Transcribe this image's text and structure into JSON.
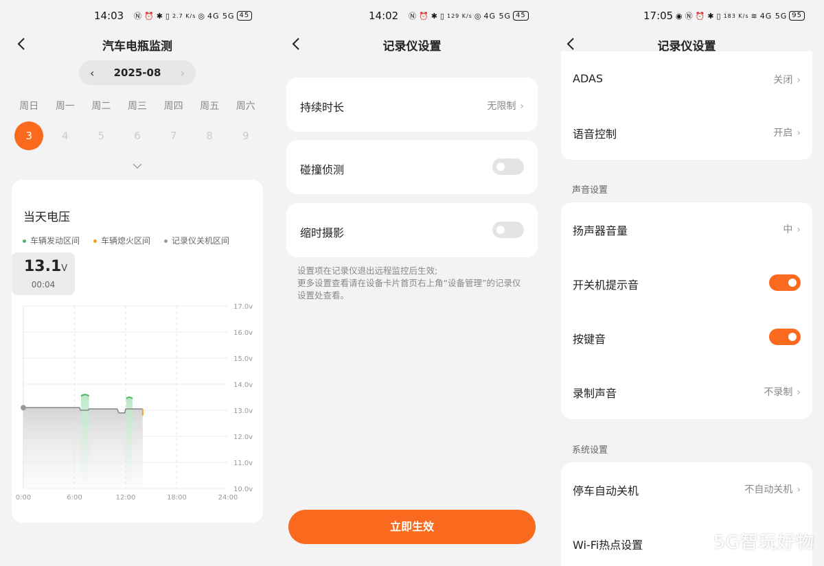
{
  "panel1": {
    "status": {
      "time": "14:03",
      "speed": "2.7 K/s",
      "network": "4G 5G",
      "battery": "45"
    },
    "nav": {
      "title": "汽车电瓶监测"
    },
    "month": "2025-08",
    "weekdays": [
      "周日",
      "周一",
      "周二",
      "周三",
      "周四",
      "周五",
      "周六"
    ],
    "dates": [
      "3",
      "4",
      "5",
      "6",
      "7",
      "8",
      "9"
    ],
    "card_title": "当天电压",
    "legend": [
      {
        "label": "车辆发动区间",
        "color": "#4cb96a"
      },
      {
        "label": "车辆熄火区间",
        "color": "#f0a020"
      },
      {
        "label": "记录仪关机区间",
        "color": "#999999"
      }
    ],
    "tooltip": {
      "value": "13.1",
      "unit": "V",
      "time": "00:04"
    }
  },
  "chart_data": {
    "type": "area",
    "title": "当天电压",
    "x_ticks": [
      "0:00",
      "6:00",
      "12:00",
      "18:00",
      "24:00"
    ],
    "y_ticks": [
      "17.0v",
      "16.0v",
      "15.0v",
      "14.0v",
      "13.0v",
      "12.0v",
      "11.0v",
      "10.0v"
    ],
    "ylim": [
      10,
      17
    ],
    "xlim": [
      0,
      24
    ],
    "grid": true,
    "series": [
      {
        "x": [
          0,
          6.6,
          6.7,
          7.6,
          7.7,
          11.0,
          11.2,
          11.9,
          12.0,
          12.7,
          12.8,
          14.0
        ],
        "y": [
          13.1,
          13.1,
          13.0,
          13.0,
          13.05,
          13.05,
          12.9,
          12.9,
          13.05,
          13.05,
          13.05,
          13.05
        ]
      }
    ],
    "run_intervals": [
      [
        6.6,
        7.7,
        13.6
      ],
      [
        11.9,
        12.8,
        13.5
      ]
    ],
    "stop_marker": 14.0
  },
  "panel2": {
    "status": {
      "time": "14:02",
      "speed": "129 K/s",
      "network": "4G 5G",
      "battery": "45"
    },
    "nav": {
      "title": "记录仪设置"
    },
    "duration": {
      "label": "持续时长",
      "value": "无限制"
    },
    "collision": {
      "label": "碰撞侦测"
    },
    "timelapse": {
      "label": "缩时摄影"
    },
    "note": "设置项在记录仪退出远程监控后生效;\n更多设置查看请在设备卡片首页右上角“设备管理”的记录仪设置处查看。",
    "cta": "立即生效"
  },
  "panel3": {
    "status": {
      "time": "17:05",
      "speed": "183 K/s",
      "network": "4G 5G",
      "battery": "95"
    },
    "nav": {
      "title": "记录仪设置"
    },
    "adas": {
      "label": "ADAS",
      "value": "关闭"
    },
    "voice": {
      "label": "语音控制",
      "value": "开启"
    },
    "sound_section": "声音设置",
    "speaker": {
      "label": "扬声器音量",
      "value": "中"
    },
    "power_tone": {
      "label": "开关机提示音"
    },
    "key_tone": {
      "label": "按键音"
    },
    "record_sound": {
      "label": "录制声音",
      "value": "不录制"
    },
    "system_section": "系统设置",
    "auto_off": {
      "label": "停车自动关机",
      "value": "不自动关机"
    },
    "wifi": {
      "label": "Wi-Fi热点设置"
    },
    "watermark": "5G智玩好物"
  },
  "colors": {
    "accent": "#fa6a1e",
    "bg": "#f3f3f5",
    "card": "#ffffff"
  }
}
